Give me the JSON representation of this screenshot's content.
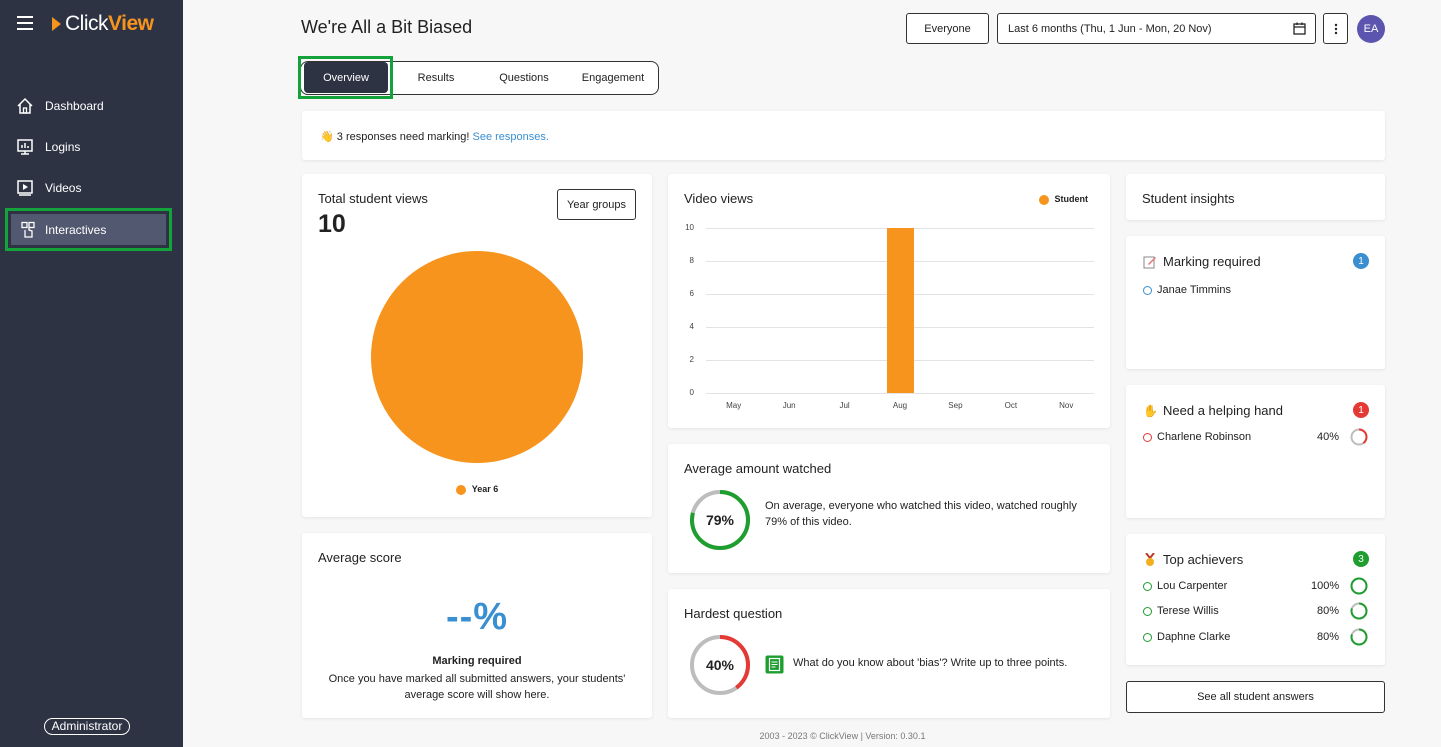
{
  "app": {
    "brand_prefix": "Click",
    "brand_suffix": "View"
  },
  "sidebar": {
    "items": [
      {
        "label": "Dashboard",
        "icon": "home-icon"
      },
      {
        "label": "Logins",
        "icon": "login-chart-icon"
      },
      {
        "label": "Videos",
        "icon": "video-play-icon"
      },
      {
        "label": "Interactives",
        "icon": "interactive-hand-icon",
        "active": true
      }
    ],
    "role_badge": "Administrator"
  },
  "header": {
    "title": "We're All a Bit Biased",
    "audience_button": "Everyone",
    "date_range": "Last 6 months (Thu, 1 Jun - Mon, 20 Nov)",
    "avatar_initials": "EA"
  },
  "tabs": [
    {
      "label": "Overview",
      "active": true
    },
    {
      "label": "Results"
    },
    {
      "label": "Questions"
    },
    {
      "label": "Engagement"
    }
  ],
  "notice": {
    "text": "3 responses need marking!",
    "link": "See responses."
  },
  "total_views": {
    "title": "Total student views",
    "value": "10",
    "button": "Year groups",
    "legend": "Year 6"
  },
  "video_views": {
    "title": "Video views",
    "legend": "Student"
  },
  "chart_data": [
    {
      "type": "pie",
      "labels": [
        "Year 6"
      ],
      "values": [
        10
      ],
      "colors": [
        "#f7941d"
      ]
    },
    {
      "type": "bar",
      "title": "Video views",
      "categories": [
        "May",
        "Jun",
        "Jul",
        "Aug",
        "Sep",
        "Oct",
        "Nov"
      ],
      "series": [
        {
          "name": "Student",
          "values": [
            0,
            0,
            0,
            10,
            0,
            0,
            0
          ],
          "color": "#f7941d"
        }
      ],
      "ylim": [
        0,
        10
      ],
      "yticks": [
        "0",
        "2",
        "4",
        "6",
        "8",
        "10"
      ],
      "grid": true,
      "legend": "top-right"
    }
  ],
  "avg_watched": {
    "title": "Average amount watched",
    "value": 79,
    "label": "79%",
    "text": "On average, everyone who watched this video, watched roughly 79% of this video."
  },
  "avg_score": {
    "title": "Average score",
    "value": "--%",
    "heading": "Marking required",
    "text": "Once you have marked all submitted answers, your students' average score will show here."
  },
  "hardest": {
    "title": "Hardest question",
    "value": 40,
    "label": "40%",
    "question": "What do you know about 'bias'? Write up to three points."
  },
  "insights": {
    "title": "Student insights",
    "marking": {
      "title": "Marking required",
      "count": "1",
      "students": [
        {
          "name": "Janae Timmins"
        }
      ]
    },
    "helping": {
      "title": "Need a helping hand",
      "count": "1",
      "students": [
        {
          "name": "Charlene Robinson",
          "pct": "40%",
          "value": 40
        }
      ]
    },
    "top": {
      "title": "Top achievers",
      "count": "3",
      "students": [
        {
          "name": "Lou Carpenter",
          "pct": "100%",
          "value": 100
        },
        {
          "name": "Terese Willis",
          "pct": "80%",
          "value": 80
        },
        {
          "name": "Daphne Clarke",
          "pct": "80%",
          "value": 80
        }
      ]
    },
    "see_all": "See all student answers"
  },
  "colors": {
    "accent": "#f7941d",
    "sidebar": "#2e3344",
    "highlight": "#14a33a",
    "link": "#3a8fd1",
    "danger": "#e53935",
    "success": "#1e9e2f",
    "info": "#3a8fd1"
  },
  "footer": "2003 - 2023 © ClickView | Version: 0.30.1"
}
